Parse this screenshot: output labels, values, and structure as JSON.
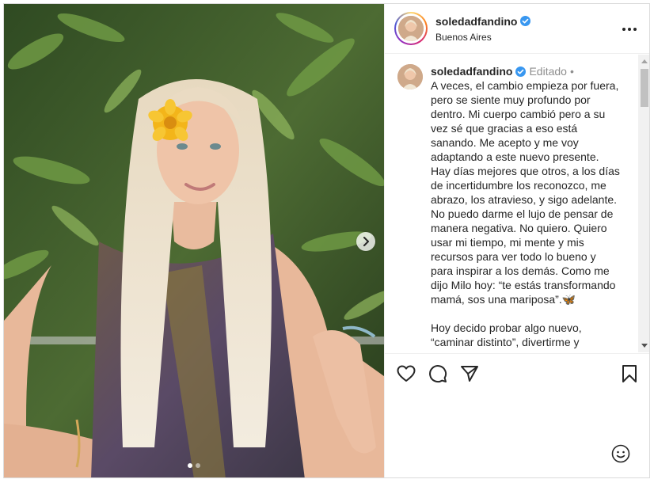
{
  "post": {
    "username": "soledadfandino",
    "location": "Buenos Aires",
    "verified": true,
    "media": {
      "description_icon": "photo",
      "carousel_dots": 2,
      "active_dot": 0
    }
  },
  "caption": {
    "username": "soledadfandino",
    "edited_label": "Editado",
    "separator": "•",
    "text": "A veces, el cambio empieza por fuera, pero se siente muy profundo por dentro. Mi cuerpo cambió pero a su vez sé que gracias a eso está sanando. Me acepto y me voy adaptando a este nuevo presente. Hay días mejores que otros, a los días de incertidumbre los reconozco, me abrazo, los atravieso, y sigo adelante. No puedo darme el lujo de pensar de manera negativa. No quiero. Quiero usar mi tiempo, mi mente y mis recursos para ver todo lo bueno y para inspirar a los demás. Como me dijo Milo hoy: “te estás transformando mamá, sos una mariposa”.🦋\n\nHoy decido probar algo nuevo, “caminar distinto”, divertirme y"
  },
  "icons": {
    "verified": "verified-badge-icon",
    "more": "more-options-icon",
    "like": "heart-icon",
    "comment": "comment-icon",
    "share": "paper-plane-icon",
    "save": "bookmark-icon",
    "emoji": "smiley-icon",
    "next": "chevron-right-icon"
  },
  "colors": {
    "verified_blue": "#3897f0",
    "text": "#262626",
    "muted": "#8e8e8e",
    "border": "#dbdbdb"
  }
}
